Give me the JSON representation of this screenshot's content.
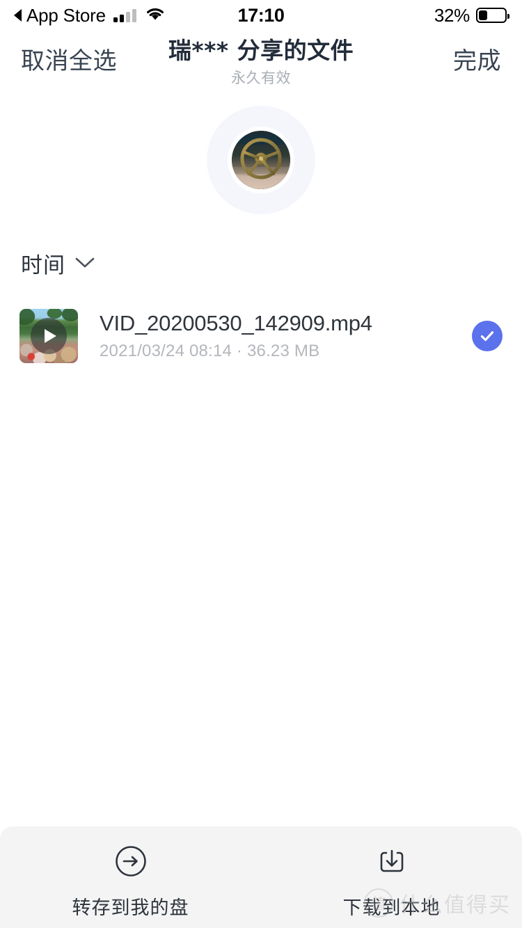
{
  "status_bar": {
    "back_label": "App Store",
    "back_icon": "back-triangle-icon",
    "signal_icon": "cellular-signal-icon",
    "wifi_icon": "wifi-icon",
    "time": "17:10",
    "battery_percent": "32%",
    "battery_icon": "battery-icon",
    "battery_level": 32
  },
  "nav": {
    "left_button": "取消全选",
    "right_button": "完成",
    "title": "瑞*** 分享的文件",
    "subtitle": "永久有效"
  },
  "avatar": {
    "name": "owner-avatar",
    "halo_color": "#f4f6fc",
    "description": "ship-wheel-photo"
  },
  "section": {
    "label": "时间",
    "chevron_icon": "chevron-down-icon"
  },
  "files": [
    {
      "name": "VID_20200530_142909.mp4",
      "date": "2021/03/24 08:14",
      "separator": "·",
      "size": "36.23 MB",
      "meta": "2021/03/24 08:14 · 36.23 MB",
      "thumbnail": "video-thumbnail",
      "play_icon": "play-icon",
      "selected": true,
      "check_icon": "check-icon",
      "check_color": "#5c71ec"
    }
  ],
  "bottom_bar": {
    "actions": [
      {
        "label": "转存到我的盘",
        "icon": "arrow-right-circle-icon"
      },
      {
        "label": "下载到本地",
        "icon": "download-icon"
      }
    ]
  },
  "watermark": {
    "badge": "值",
    "text": "什么值得买"
  }
}
